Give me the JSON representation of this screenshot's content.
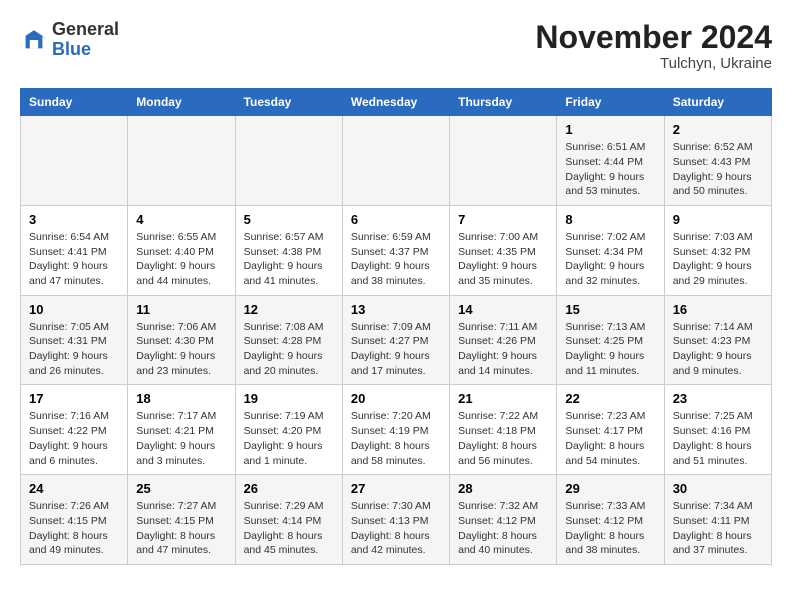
{
  "logo": {
    "general": "General",
    "blue": "Blue"
  },
  "header": {
    "month": "November 2024",
    "location": "Tulchyn, Ukraine"
  },
  "weekdays": [
    "Sunday",
    "Monday",
    "Tuesday",
    "Wednesday",
    "Thursday",
    "Friday",
    "Saturday"
  ],
  "weeks": [
    [
      {
        "day": "",
        "info": ""
      },
      {
        "day": "",
        "info": ""
      },
      {
        "day": "",
        "info": ""
      },
      {
        "day": "",
        "info": ""
      },
      {
        "day": "",
        "info": ""
      },
      {
        "day": "1",
        "info": "Sunrise: 6:51 AM\nSunset: 4:44 PM\nDaylight: 9 hours and 53 minutes."
      },
      {
        "day": "2",
        "info": "Sunrise: 6:52 AM\nSunset: 4:43 PM\nDaylight: 9 hours and 50 minutes."
      }
    ],
    [
      {
        "day": "3",
        "info": "Sunrise: 6:54 AM\nSunset: 4:41 PM\nDaylight: 9 hours and 47 minutes."
      },
      {
        "day": "4",
        "info": "Sunrise: 6:55 AM\nSunset: 4:40 PM\nDaylight: 9 hours and 44 minutes."
      },
      {
        "day": "5",
        "info": "Sunrise: 6:57 AM\nSunset: 4:38 PM\nDaylight: 9 hours and 41 minutes."
      },
      {
        "day": "6",
        "info": "Sunrise: 6:59 AM\nSunset: 4:37 PM\nDaylight: 9 hours and 38 minutes."
      },
      {
        "day": "7",
        "info": "Sunrise: 7:00 AM\nSunset: 4:35 PM\nDaylight: 9 hours and 35 minutes."
      },
      {
        "day": "8",
        "info": "Sunrise: 7:02 AM\nSunset: 4:34 PM\nDaylight: 9 hours and 32 minutes."
      },
      {
        "day": "9",
        "info": "Sunrise: 7:03 AM\nSunset: 4:32 PM\nDaylight: 9 hours and 29 minutes."
      }
    ],
    [
      {
        "day": "10",
        "info": "Sunrise: 7:05 AM\nSunset: 4:31 PM\nDaylight: 9 hours and 26 minutes."
      },
      {
        "day": "11",
        "info": "Sunrise: 7:06 AM\nSunset: 4:30 PM\nDaylight: 9 hours and 23 minutes."
      },
      {
        "day": "12",
        "info": "Sunrise: 7:08 AM\nSunset: 4:28 PM\nDaylight: 9 hours and 20 minutes."
      },
      {
        "day": "13",
        "info": "Sunrise: 7:09 AM\nSunset: 4:27 PM\nDaylight: 9 hours and 17 minutes."
      },
      {
        "day": "14",
        "info": "Sunrise: 7:11 AM\nSunset: 4:26 PM\nDaylight: 9 hours and 14 minutes."
      },
      {
        "day": "15",
        "info": "Sunrise: 7:13 AM\nSunset: 4:25 PM\nDaylight: 9 hours and 11 minutes."
      },
      {
        "day": "16",
        "info": "Sunrise: 7:14 AM\nSunset: 4:23 PM\nDaylight: 9 hours and 9 minutes."
      }
    ],
    [
      {
        "day": "17",
        "info": "Sunrise: 7:16 AM\nSunset: 4:22 PM\nDaylight: 9 hours and 6 minutes."
      },
      {
        "day": "18",
        "info": "Sunrise: 7:17 AM\nSunset: 4:21 PM\nDaylight: 9 hours and 3 minutes."
      },
      {
        "day": "19",
        "info": "Sunrise: 7:19 AM\nSunset: 4:20 PM\nDaylight: 9 hours and 1 minute."
      },
      {
        "day": "20",
        "info": "Sunrise: 7:20 AM\nSunset: 4:19 PM\nDaylight: 8 hours and 58 minutes."
      },
      {
        "day": "21",
        "info": "Sunrise: 7:22 AM\nSunset: 4:18 PM\nDaylight: 8 hours and 56 minutes."
      },
      {
        "day": "22",
        "info": "Sunrise: 7:23 AM\nSunset: 4:17 PM\nDaylight: 8 hours and 54 minutes."
      },
      {
        "day": "23",
        "info": "Sunrise: 7:25 AM\nSunset: 4:16 PM\nDaylight: 8 hours and 51 minutes."
      }
    ],
    [
      {
        "day": "24",
        "info": "Sunrise: 7:26 AM\nSunset: 4:15 PM\nDaylight: 8 hours and 49 minutes."
      },
      {
        "day": "25",
        "info": "Sunrise: 7:27 AM\nSunset: 4:15 PM\nDaylight: 8 hours and 47 minutes."
      },
      {
        "day": "26",
        "info": "Sunrise: 7:29 AM\nSunset: 4:14 PM\nDaylight: 8 hours and 45 minutes."
      },
      {
        "day": "27",
        "info": "Sunrise: 7:30 AM\nSunset: 4:13 PM\nDaylight: 8 hours and 42 minutes."
      },
      {
        "day": "28",
        "info": "Sunrise: 7:32 AM\nSunset: 4:12 PM\nDaylight: 8 hours and 40 minutes."
      },
      {
        "day": "29",
        "info": "Sunrise: 7:33 AM\nSunset: 4:12 PM\nDaylight: 8 hours and 38 minutes."
      },
      {
        "day": "30",
        "info": "Sunrise: 7:34 AM\nSunset: 4:11 PM\nDaylight: 8 hours and 37 minutes."
      }
    ]
  ]
}
